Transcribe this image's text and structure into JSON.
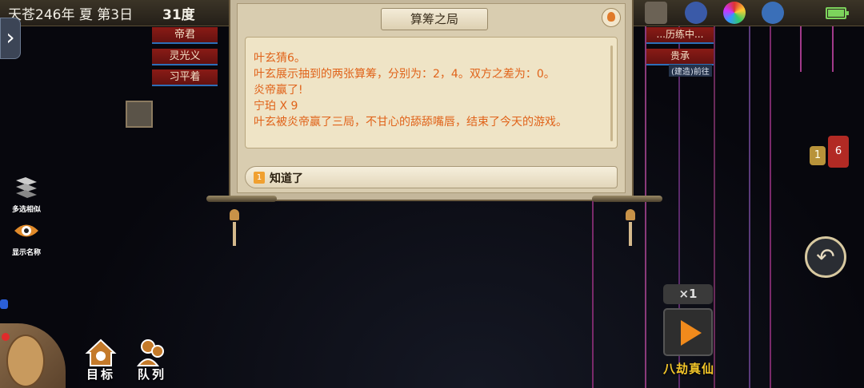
{
  "status_bar": {
    "date": "天苍246年 夏 第3日",
    "temperature": "31度"
  },
  "top_icons": [
    "save-icon",
    "compass-icon",
    "palette-icon",
    "gear-icon",
    "battery-icon"
  ],
  "name_tags_left": [
    "帝君",
    "灵光义",
    "习平着"
  ],
  "name_tags_right": [
    "...历练中...",
    "贵承"
  ],
  "build_label": "(建造)前往",
  "side_buttons": {
    "multi_select": "多选相似",
    "show_names": "显示名称"
  },
  "dialog": {
    "title": "算筹之局",
    "lines": [
      "叶玄猜6。",
      "叶玄展示抽到的两张算筹，分别为：2，4。双方之差为：0。",
      "炎帝赢了!",
      "宁珀 X 9",
      "叶玄被炎帝赢了三局，不甘心的舔舔嘴唇，结束了今天的游戏。"
    ],
    "choice_number": "1",
    "choice_text": "知道了"
  },
  "bubbles": {
    "yellow": "1",
    "red": "6"
  },
  "speed": "×1",
  "play_label": "八劫真仙",
  "nav": {
    "goal": "目标",
    "team": "队列"
  },
  "colors": {
    "dialog_text": "#e0631a",
    "tag_red": "#8a1b16",
    "accent_orange": "#f08a1c",
    "label_yellow": "#f3c629"
  }
}
